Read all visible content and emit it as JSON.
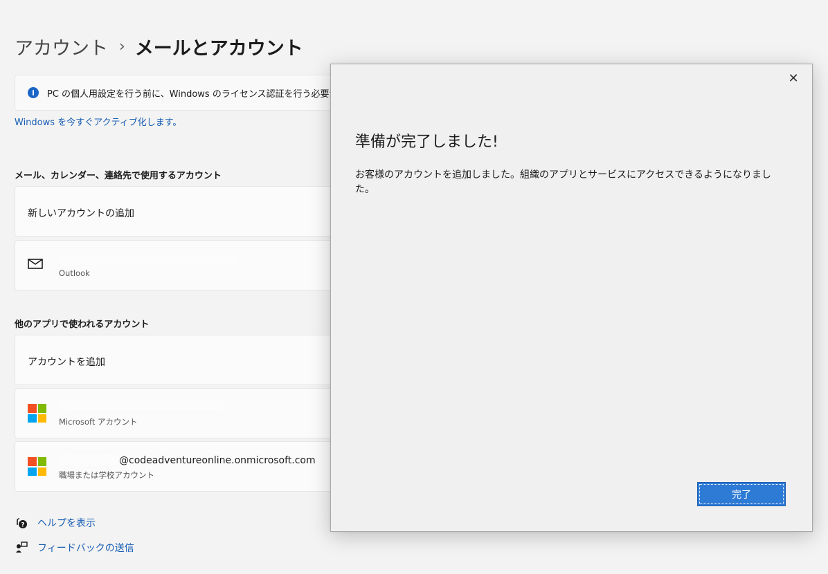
{
  "breadcrumb": {
    "parent": "アカウント",
    "separator": "›",
    "current": "メールとアカウント"
  },
  "notice": {
    "text": "PC の個人用設定を行う前に、Windows のライセンス認証を行う必要があります。",
    "link": "Windows を今すぐアクティブ化します。"
  },
  "section_email": {
    "heading": "メール、カレンダー、連絡先で使用するアカウント",
    "add_label": "新しいアカウントの追加",
    "outlook_sub": "Outlook"
  },
  "section_other": {
    "heading": "他のアプリで使われるアカウント",
    "add_label": "アカウントを追加",
    "microsoft_sub": "Microsoft アカウント",
    "work_email": "@codeadventureonline.onmicrosoft.com",
    "work_sub": "職場または学校アカウント"
  },
  "footer": {
    "help": "ヘルプを表示",
    "feedback": "フィードバックの送信"
  },
  "dialog": {
    "close_glyph": "✕",
    "title": "準備が完了しました!",
    "message": "お客様のアカウントを追加しました。組織のアプリとサービスにアクセスできるようになりました。",
    "done_label": "完了"
  },
  "colors": {
    "accent": "#2e7bd6",
    "link": "#1a5fb4",
    "info": "#1a66c7"
  },
  "icons": [
    "info-icon",
    "mail-icon",
    "microsoft-logo-icon",
    "help-icon",
    "feedback-icon",
    "close-icon"
  ]
}
